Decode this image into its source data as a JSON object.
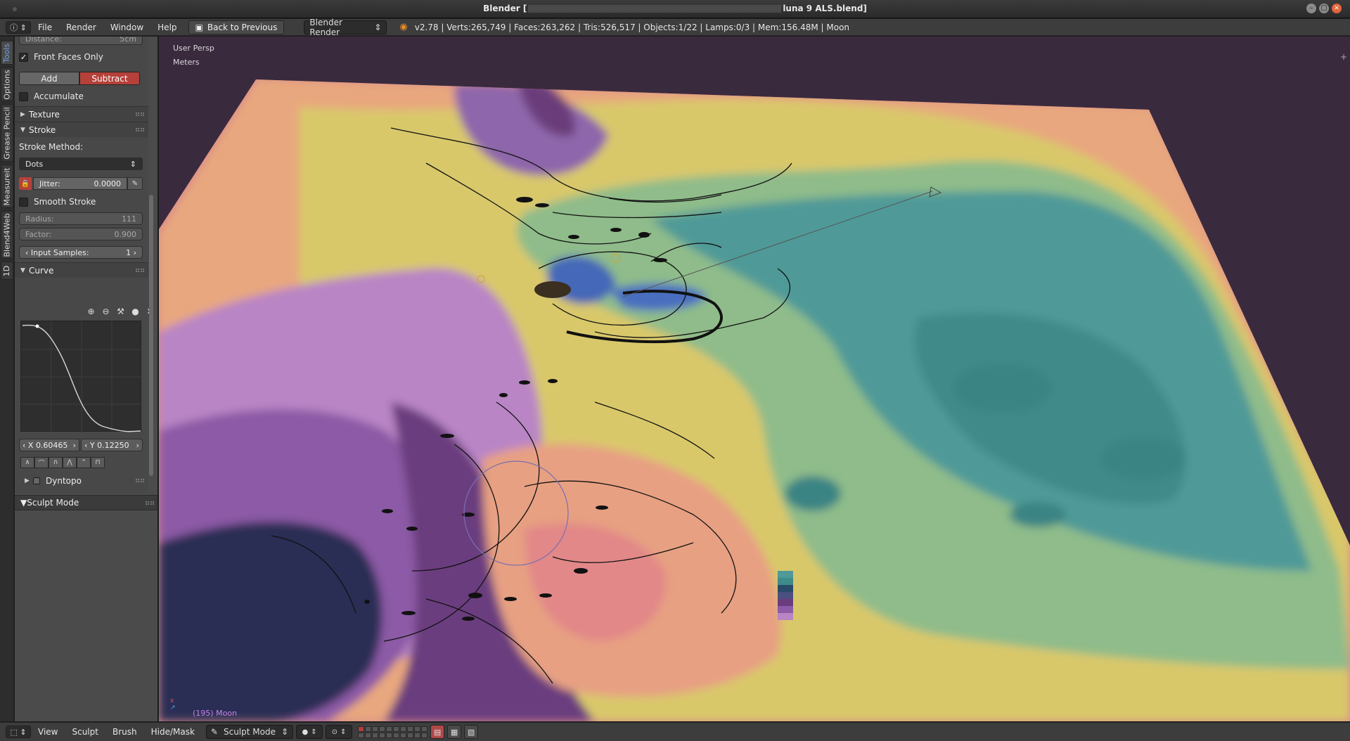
{
  "window": {
    "title_prefix": "Blender [",
    "title_suffix": "luna  9 ALS.blend]"
  },
  "infobar": {
    "menus": [
      "File",
      "Render",
      "Window",
      "Help"
    ],
    "back_button": "Back to Previous",
    "render_engine": "Blender Render",
    "stats": "v2.78 | Verts:265,749 | Faces:263,262 | Tris:526,517 | Objects:1/22 | Lamps:0/3 | Mem:156.48M | Moon"
  },
  "tabs": [
    "Tools",
    "Options",
    "Grease Pencil",
    "Measureit",
    "Blend4Web",
    "1D"
  ],
  "toolshelf": {
    "distance_label": "Distance:",
    "distance_value": "5cm",
    "front_faces_only": "Front Faces Only",
    "add_label": "Add",
    "subtract_label": "Subtract",
    "accumulate": "Accumulate",
    "texture_panel": "Texture",
    "stroke_panel": "Stroke",
    "stroke_method_label": "Stroke Method:",
    "stroke_method_value": "Dots",
    "jitter_label": "Jitter:",
    "jitter_value": "0.0000",
    "smooth_stroke": "Smooth Stroke",
    "radius_label": "Radius:",
    "radius_value": "111",
    "factor_label": "Factor:",
    "factor_value": "0.900",
    "input_samples_label": "Input Samples:",
    "input_samples_value": "1",
    "curve_panel": "Curve",
    "curve_x": "X 0.60465",
    "curve_y": "Y 0.12250",
    "dyntopo_panel": "Dyntopo",
    "sculpt_mode_panel": "Sculpt Mode"
  },
  "viewport": {
    "view_name": "User Persp",
    "units": "Meters",
    "object_label": "(195) Moon"
  },
  "bottombar": {
    "menus": [
      "View",
      "Sculpt",
      "Brush",
      "Hide/Mask"
    ],
    "mode": "Sculpt Mode"
  },
  "colors": {
    "accent_red": "#b5413a",
    "tab_active_text": "#6fa0e0",
    "object_label": "#c783e8"
  }
}
